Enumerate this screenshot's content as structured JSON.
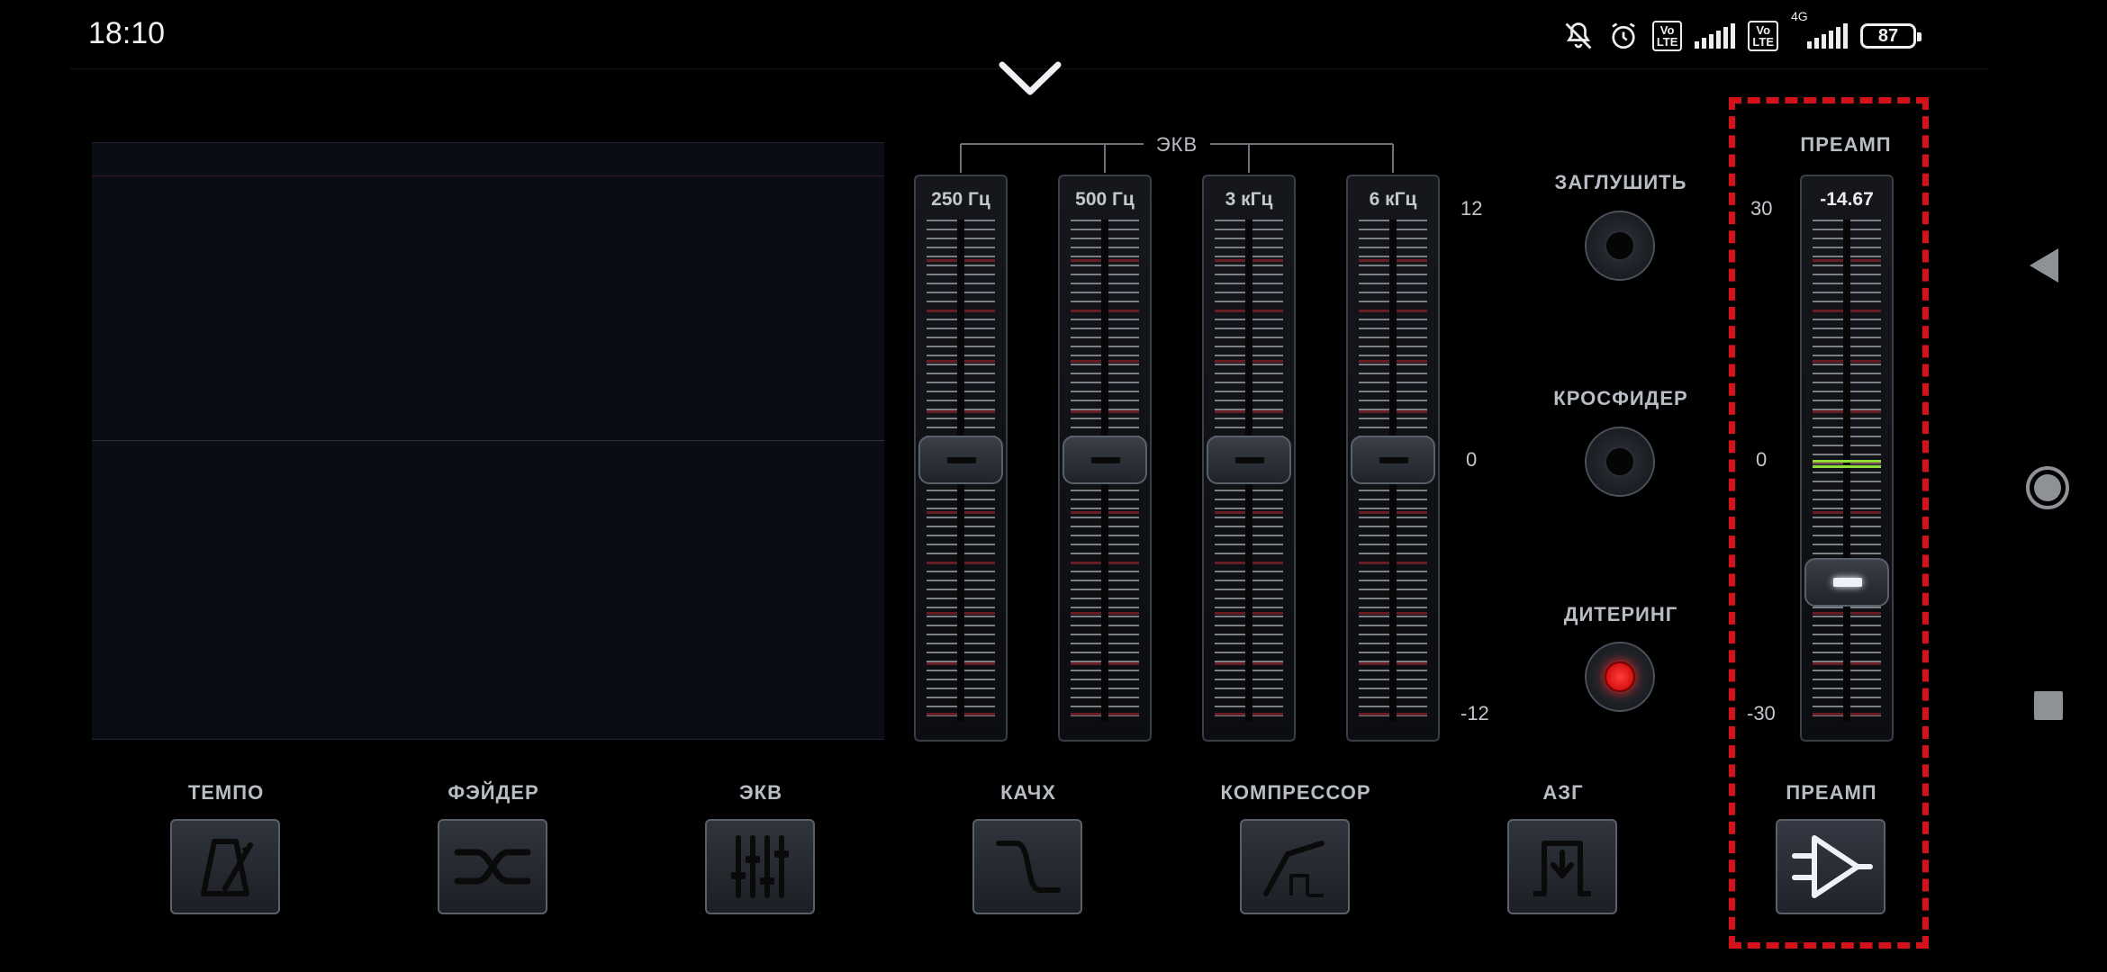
{
  "status_bar": {
    "time": "18:10",
    "icons": [
      "mute-icon",
      "alarm-icon",
      "volte-icon",
      "signal-icon",
      "volte-icon",
      "4g-signal-icon"
    ],
    "volte_label": "Vo\nLTE",
    "network": "4G",
    "battery": "87"
  },
  "eq": {
    "title": "ЭКВ",
    "bands": [
      {
        "label": "250 Гц",
        "gain": 0
      },
      {
        "label": "500 Гц",
        "gain": 0
      },
      {
        "label": "3 кГц",
        "gain": 0
      },
      {
        "label": "6 кГц",
        "gain": 0
      }
    ],
    "scale": {
      "top": "12",
      "mid": "0",
      "bottom": "-12"
    }
  },
  "toggles": {
    "mute": {
      "label": "ЗАГЛУШИТЬ",
      "on": false
    },
    "crossfader": {
      "label": "КРОСФИДЕР",
      "on": false
    },
    "dithering": {
      "label": "ДИТЕРИНГ",
      "on": true
    }
  },
  "preamp": {
    "title": "ПРЕАМП",
    "value": "-14.67",
    "scale": {
      "top": "30",
      "mid": "0",
      "bottom": "-30"
    }
  },
  "tabs": [
    {
      "label": "ТЕМПО",
      "icon": "metronome-icon"
    },
    {
      "label": "ФЭЙДЕР",
      "icon": "crossfade-icon"
    },
    {
      "label": "ЭКВ",
      "icon": "equalizer-icon"
    },
    {
      "label": "КАЧХ",
      "icon": "frequency-response-icon"
    },
    {
      "label": "КОМПРЕССОР",
      "icon": "compressor-icon"
    },
    {
      "label": "АЗГ",
      "icon": "gate-icon"
    },
    {
      "label": "ПРЕАМП",
      "icon": "amplifier-icon"
    }
  ],
  "colors": {
    "highlight": "#d3121c",
    "dither_on": "#ff2020",
    "preamp_zero": "#8fdc3a"
  }
}
